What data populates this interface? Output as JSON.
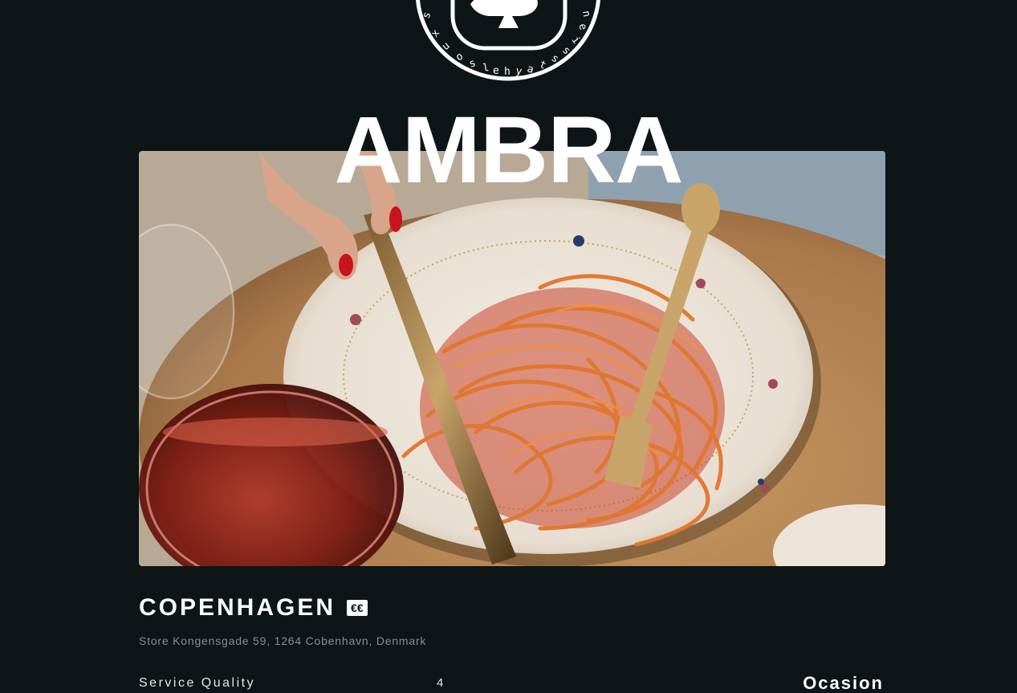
{
  "logo": {
    "icon": "goose-seal-icon",
    "ring_text": "s t a y h e l s i n k i"
  },
  "restaurant": {
    "name": "AMBRA",
    "city": "COPENHAGEN",
    "price": "€€",
    "address": "Store Kongensgade 59, 1264 Cobenhavn, Denmark"
  },
  "hero_image": {
    "icon": "pasta-dish-photo"
  },
  "ratings": {
    "service_label": "Service Quality",
    "service_value": "4",
    "occasion_label": "Ocasion"
  },
  "colors": {
    "background": "#0d1516",
    "text": "#ffffff",
    "muted": "#8a8f91"
  }
}
